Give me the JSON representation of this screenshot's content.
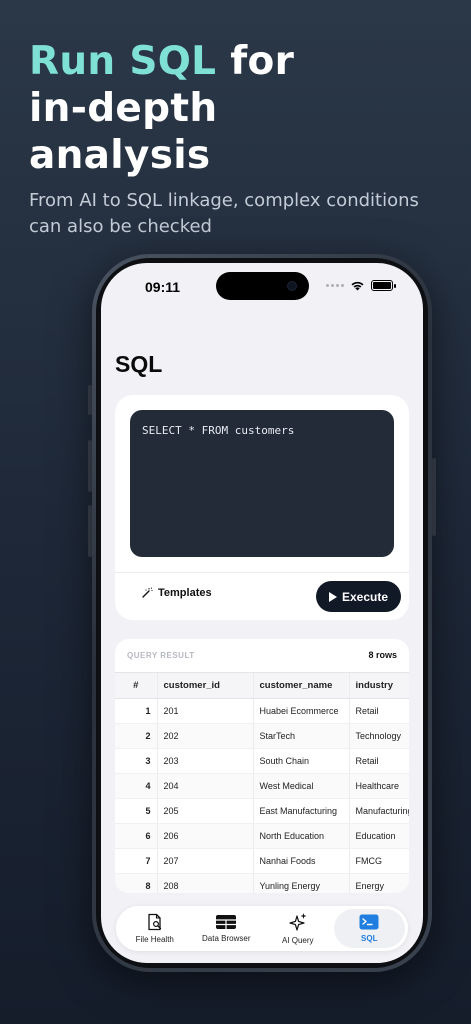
{
  "marketing": {
    "headline_accent": "Run SQL",
    "headline_rest_1": " for",
    "headline_line_2": "in-depth",
    "headline_line_3": "analysis",
    "subline": "From AI to SQL linkage, complex conditions can also be checked"
  },
  "status_bar": {
    "time": "09:11"
  },
  "page": {
    "title": "SQL"
  },
  "editor": {
    "query": "SELECT * FROM customers",
    "templates_label": "Templates",
    "execute_label": "Execute"
  },
  "results": {
    "label": "QUERY RESULT",
    "count": "8 rows",
    "columns": [
      "#",
      "customer_id",
      "customer_name",
      "industry"
    ],
    "rows": [
      [
        "1",
        "201",
        "Huabei Ecommerce",
        "Retail"
      ],
      [
        "2",
        "202",
        "StarTech",
        "Technology"
      ],
      [
        "3",
        "203",
        "South Chain",
        "Retail"
      ],
      [
        "4",
        "204",
        "West Medical",
        "Healthcare"
      ],
      [
        "5",
        "205",
        "East Manufacturing",
        "Manufacturing"
      ],
      [
        "6",
        "206",
        "North Education",
        "Education"
      ],
      [
        "7",
        "207",
        "Nanhai Foods",
        "FMCG"
      ],
      [
        "8",
        "208",
        "Yunling Energy",
        "Energy"
      ]
    ]
  },
  "tabbar": {
    "items": [
      {
        "label": "File Health",
        "icon": "file-search-icon"
      },
      {
        "label": "Data Browser",
        "icon": "table-grid-icon"
      },
      {
        "label": "AI Query",
        "icon": "sparkles-icon"
      },
      {
        "label": "SQL",
        "icon": "terminal-icon",
        "active": true
      }
    ]
  },
  "colors": {
    "accent": "#7fe0d6",
    "active_tab": "#1f7ee0",
    "code_bg": "#232a38",
    "execute_bg": "#111826"
  }
}
